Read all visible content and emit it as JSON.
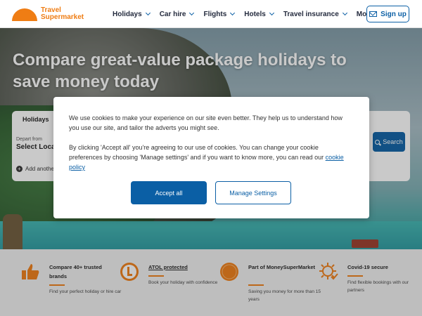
{
  "header": {
    "logo_line1": "Travel",
    "logo_line2": "Supermarket",
    "nav": [
      "Holidays",
      "Car hire",
      "Flights",
      "Hotels",
      "Travel insurance",
      "More"
    ],
    "signup_label": "Sign up"
  },
  "hero": {
    "title": "Compare great-value package holidays to save money today"
  },
  "search": {
    "tab_label": "Holidays",
    "depart_label": "Depart from",
    "depart_value": "Select Loca",
    "add_another": "Add anothe",
    "search_label": "Search"
  },
  "cookie": {
    "para1": "We use cookies to make your experience on our site even better. They help us to understand how you use our site, and tailor the adverts you might see.",
    "para2_prefix": "By clicking 'Accept all' you're agreeing to our use of cookies. You can change your cookie preferences by choosing 'Manage settings' and if you want to know more, you can read our ",
    "link_text": "cookie policy",
    "accept_label": "Accept all",
    "manage_label": "Manage Settings"
  },
  "benefits": [
    {
      "title": "Compare 40+ trusted brands",
      "desc": "Find your perfect holiday or hire car",
      "icon": "thumbs-up-icon"
    },
    {
      "title": "ATOL protected",
      "desc": "Book your holiday with confidence",
      "icon": "atol-badge-icon"
    },
    {
      "title": "Part of MoneySuperMarket",
      "desc": "Saving you money for more than 15 years",
      "icon": "moneysupermarket-badge-icon"
    },
    {
      "title": "Covid-19 secure",
      "desc": "Find flexible bookings with our partners",
      "icon": "virus-shield-icon"
    }
  ],
  "colors": {
    "brand_orange": "#ef7d14",
    "brand_blue": "#0b5fa5"
  }
}
